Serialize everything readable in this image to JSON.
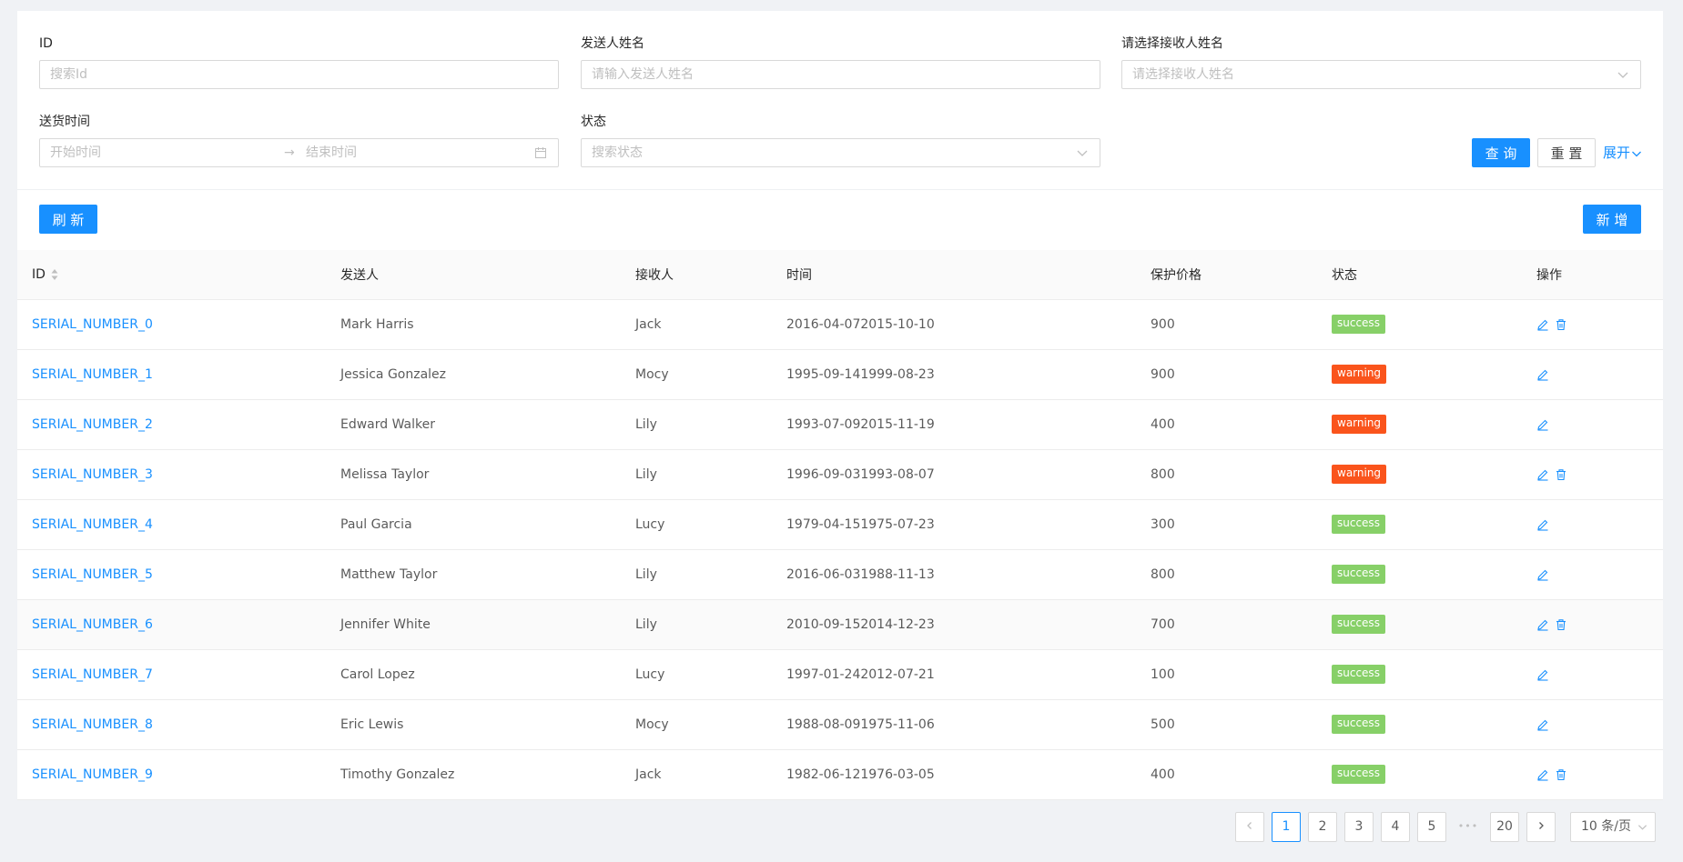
{
  "filters": {
    "id": {
      "label": "ID",
      "placeholder": "搜索Id"
    },
    "sender": {
      "label": "发送人姓名",
      "placeholder": "请输入发送人姓名"
    },
    "receiver": {
      "label": "请选择接收人姓名",
      "placeholder": "请选择接收人姓名"
    },
    "delivery_time": {
      "label": "送货时间",
      "start_placeholder": "开始时间",
      "end_placeholder": "结束时间",
      "separator": "→"
    },
    "status": {
      "label": "状态",
      "placeholder": "搜索状态"
    },
    "query_label": "查 询",
    "reset_label": "重 置",
    "expand_label": "展开"
  },
  "toolbar": {
    "refresh_label": "刷 新",
    "add_label": "新 增"
  },
  "table": {
    "columns": [
      "ID",
      "发送人",
      "接收人",
      "时间",
      "保护价格",
      "状态",
      "操作"
    ],
    "rows": [
      {
        "id": "SERIAL_NUMBER_0",
        "sender": "Mark Harris",
        "receiver": "Jack",
        "time": "2016-04-072015-10-10",
        "price": "900",
        "status": "success",
        "delete": true
      },
      {
        "id": "SERIAL_NUMBER_1",
        "sender": "Jessica Gonzalez",
        "receiver": "Mocy",
        "time": "1995-09-141999-08-23",
        "price": "900",
        "status": "warning",
        "delete": false
      },
      {
        "id": "SERIAL_NUMBER_2",
        "sender": "Edward Walker",
        "receiver": "Lily",
        "time": "1993-07-092015-11-19",
        "price": "400",
        "status": "warning",
        "delete": false
      },
      {
        "id": "SERIAL_NUMBER_3",
        "sender": "Melissa Taylor",
        "receiver": "Lily",
        "time": "1996-09-031993-08-07",
        "price": "800",
        "status": "warning",
        "delete": true
      },
      {
        "id": "SERIAL_NUMBER_4",
        "sender": "Paul Garcia",
        "receiver": "Lucy",
        "time": "1979-04-151975-07-23",
        "price": "300",
        "status": "success",
        "delete": false
      },
      {
        "id": "SERIAL_NUMBER_5",
        "sender": "Matthew Taylor",
        "receiver": "Lily",
        "time": "2016-06-031988-11-13",
        "price": "800",
        "status": "success",
        "delete": false
      },
      {
        "id": "SERIAL_NUMBER_6",
        "sender": "Jennifer White",
        "receiver": "Lily",
        "time": "2010-09-152014-12-23",
        "price": "700",
        "status": "success",
        "delete": true
      },
      {
        "id": "SERIAL_NUMBER_7",
        "sender": "Carol Lopez",
        "receiver": "Lucy",
        "time": "1997-01-242012-07-21",
        "price": "100",
        "status": "success",
        "delete": false
      },
      {
        "id": "SERIAL_NUMBER_8",
        "sender": "Eric Lewis",
        "receiver": "Mocy",
        "time": "1988-08-091975-11-06",
        "price": "500",
        "status": "success",
        "delete": false
      },
      {
        "id": "SERIAL_NUMBER_9",
        "sender": "Timothy Gonzalez",
        "receiver": "Jack",
        "time": "1982-06-121976-03-05",
        "price": "400",
        "status": "success",
        "delete": true
      }
    ]
  },
  "status_colors": {
    "success": "#87d068",
    "warning": "#fa541c"
  },
  "accent_color": "#1890ff",
  "pagination": {
    "pages": [
      "1",
      "2",
      "3",
      "4",
      "5"
    ],
    "ellipsis": "•••",
    "last_page": "20",
    "current": "1",
    "page_size_label": "10 条/页"
  }
}
